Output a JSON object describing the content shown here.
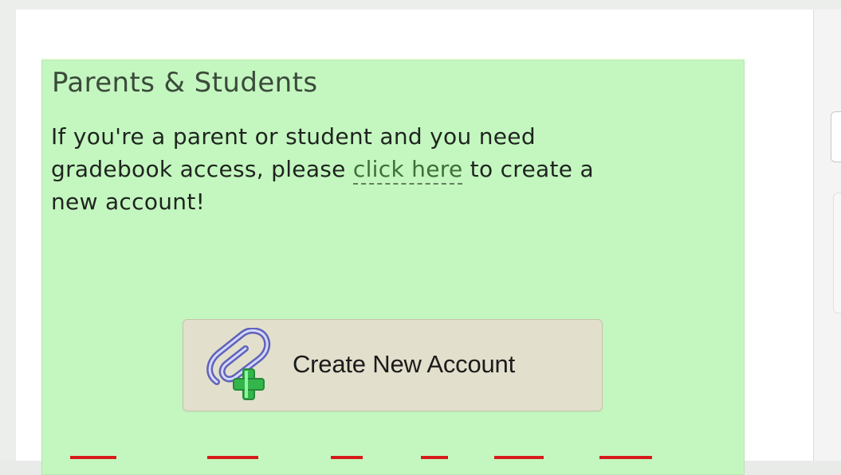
{
  "card": {
    "title": "Parents & Students",
    "text_before_link": "If you're a parent or student and you need gradebook access, please ",
    "link_text": "click here",
    "text_after_link": " to create a new account!",
    "button_label": "Create New Account",
    "background_color": "#c4f7c0"
  },
  "icons": {
    "button_icon": "paperclip-plus-icon"
  },
  "colors": {
    "link": "#3f6e3b",
    "bottom_dash": "#d71b1b"
  }
}
